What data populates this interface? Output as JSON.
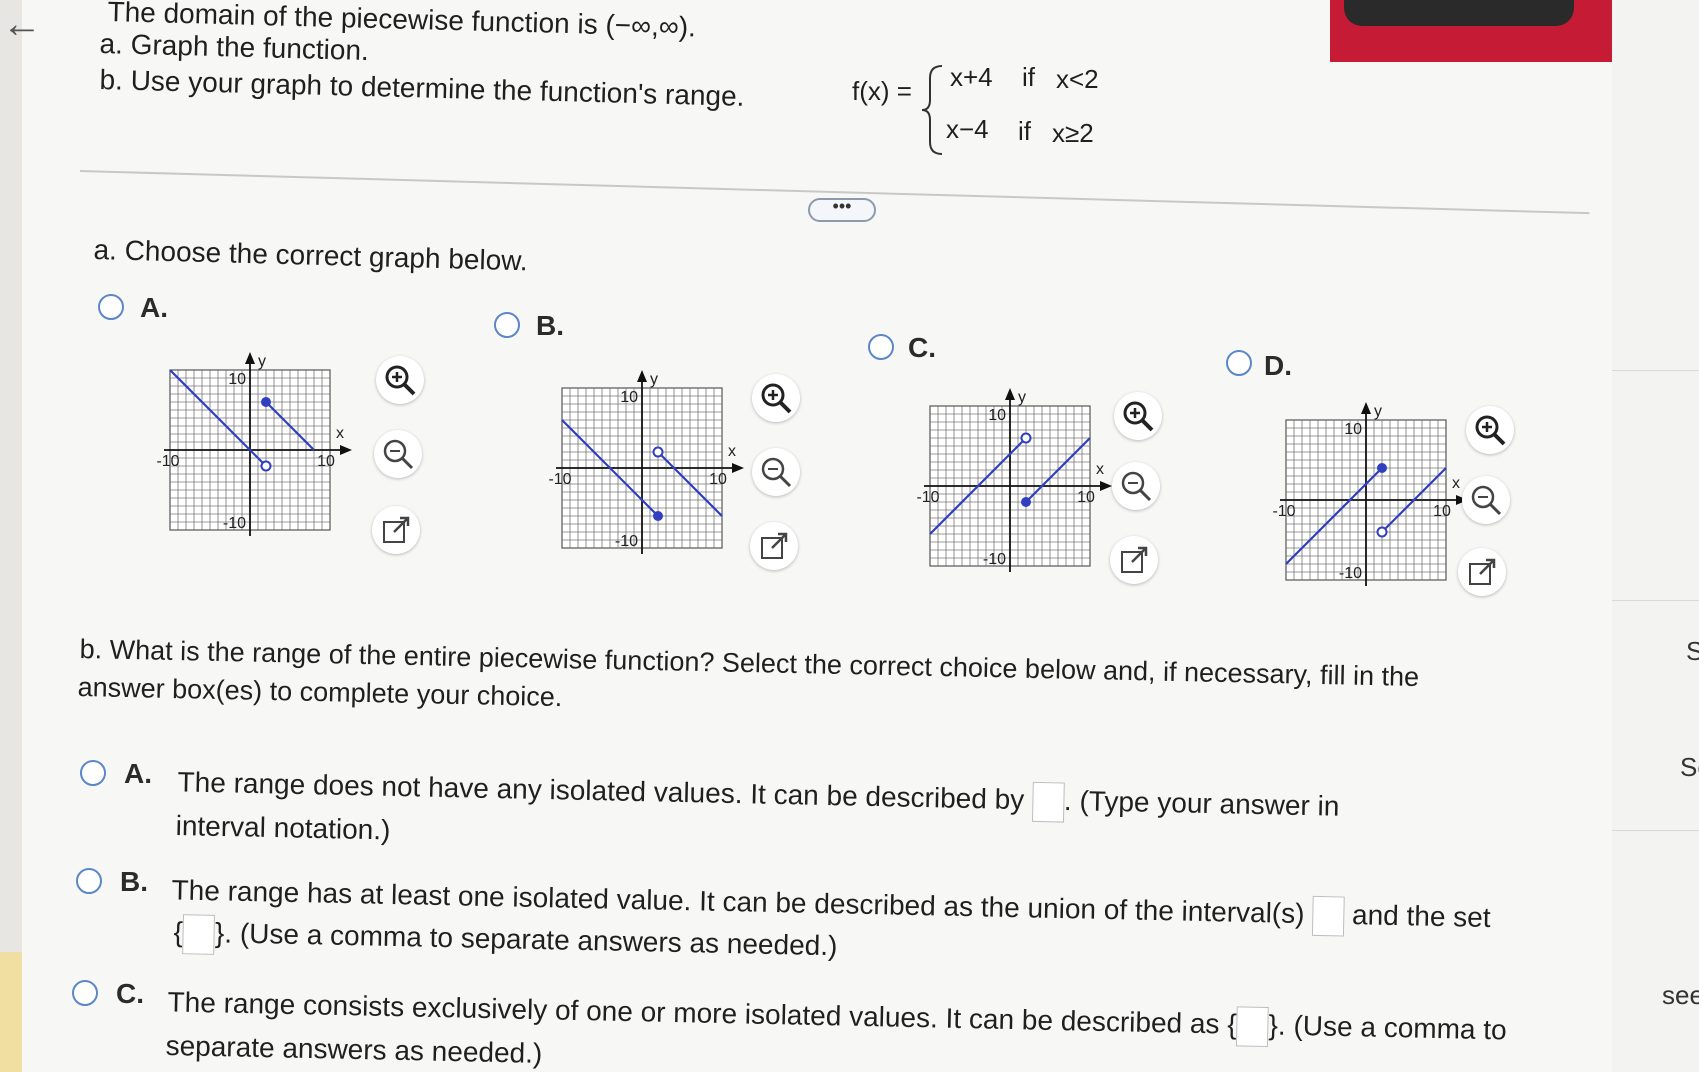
{
  "problem": {
    "line1": "The domain of the piecewise function is (−∞,∞).",
    "line_a": "a. Graph the function.",
    "line_b": "b. Use your graph to determine the function's range.",
    "fx_label": "f(x) =",
    "piece1_expr": "x+4",
    "piece1_if": "if",
    "piece1_cond": "x<2",
    "piece2_expr": "x−4",
    "piece2_if": "if",
    "piece2_cond": "x≥2",
    "more_button": "•••"
  },
  "part_a": {
    "prompt": "a. Choose the correct graph below.",
    "options": [
      {
        "label": "A.",
        "tick_top": "10",
        "tick_left": "-10",
        "tick_right": "10",
        "tick_bottom": "-10",
        "axis_x": "x",
        "axis_y": "y"
      },
      {
        "label": "B.",
        "tick_top": "10",
        "tick_left": "-10",
        "tick_right": "10",
        "tick_bottom": "-10",
        "axis_x": "x",
        "axis_y": "y"
      },
      {
        "label": "C.",
        "tick_top": "10",
        "tick_left": "-10",
        "tick_right": "10",
        "tick_bottom": "-10",
        "axis_x": "x",
        "axis_y": "y"
      },
      {
        "label": "D.",
        "tick_top": "10",
        "tick_left": "-10",
        "tick_right": "10",
        "tick_bottom": "-10",
        "axis_x": "x",
        "axis_y": "y"
      }
    ],
    "icons": [
      "zoom-in-icon",
      "zoom-out-icon",
      "open-external-icon"
    ]
  },
  "part_b": {
    "prompt_line1": "b. What is the range of the entire piecewise function? Select the correct choice below and, if necessary, fill in the",
    "prompt_line2": "answer box(es) to complete your choice.",
    "choice_a_label": "A.",
    "choice_a_text1": "The range does not have any isolated values. It can be described by",
    "choice_a_text2": ". (Type your answer in",
    "choice_a_text3": "interval notation.)",
    "choice_b_label": "B.",
    "choice_b_text1": "The range has at least one isolated value. It can be described as the union of the interval(s)",
    "choice_b_text2": "and the set",
    "choice_b_text3": ". (Use a comma to separate answers as needed.)",
    "choice_c_label": "C.",
    "choice_c_text1": "The range consists exclusively of one or more isolated values. It can be described as",
    "choice_c_text2": ". (Use a comma to",
    "choice_c_text3": "separate answers as needed.)",
    "brace_open": "{",
    "brace_close": "}"
  },
  "right_panel": {
    "items": [
      "S",
      "Se",
      "see"
    ]
  },
  "colors": {
    "accent_blue": "#2f3fbf",
    "radio_border": "#5b86c9",
    "red_tab": "#c51b35"
  }
}
